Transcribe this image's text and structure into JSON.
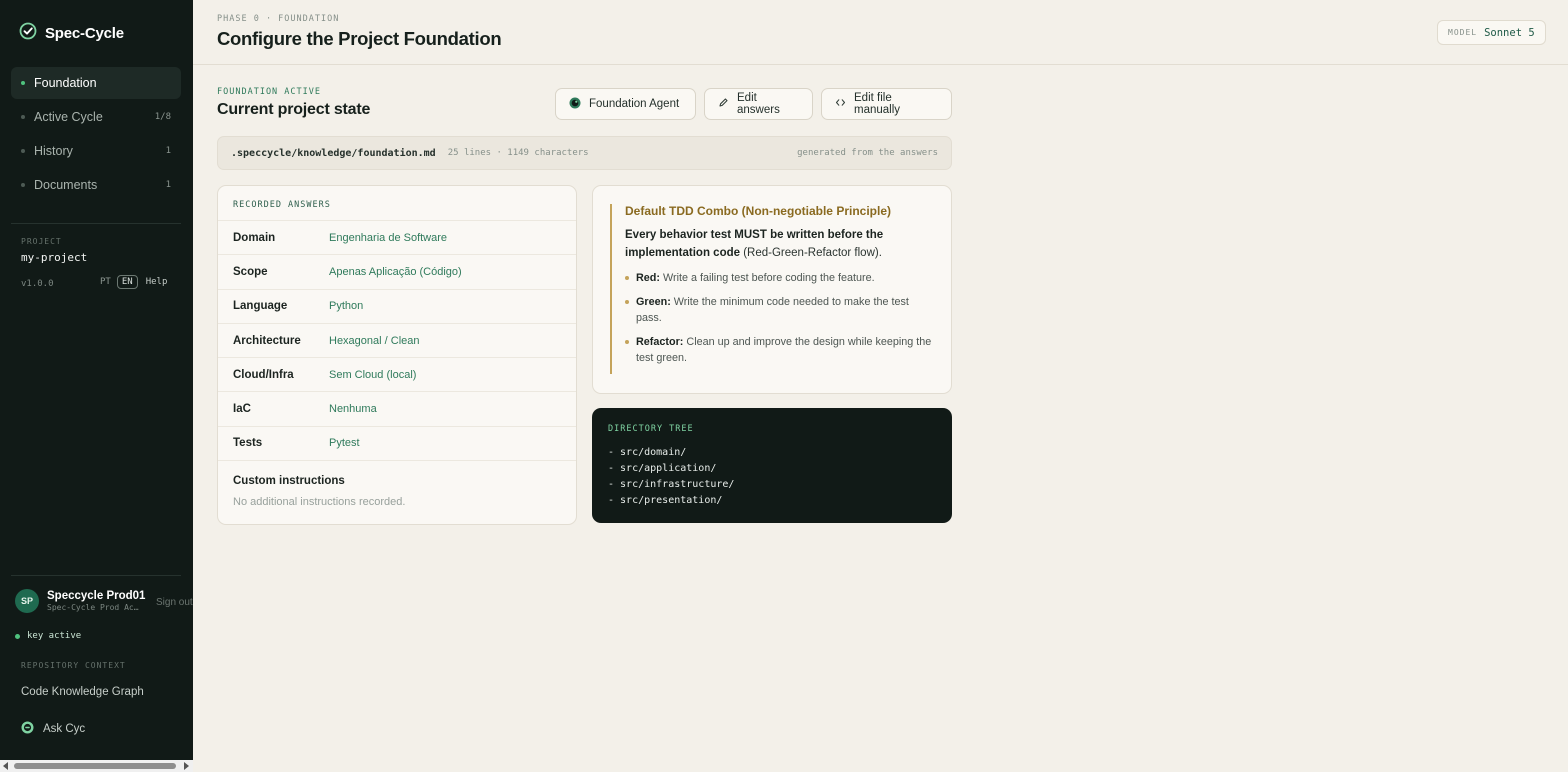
{
  "sidebar": {
    "brand": "Spec-Cycle",
    "nav": [
      {
        "label": "Foundation",
        "count": ""
      },
      {
        "label": "Active Cycle",
        "count": "1/8"
      },
      {
        "label": "History",
        "count": "1"
      },
      {
        "label": "Documents",
        "count": "1"
      }
    ],
    "project_label": "PROJECT",
    "project_name": "my-project",
    "version": "v1.0.0",
    "lang_pt": "PT",
    "lang_en": "EN",
    "help": "Help",
    "user": {
      "initials": "SP",
      "name": "Speccycle Prod01",
      "sub": "Spec-Cycle Prod Ac…",
      "signout": "Sign out"
    },
    "key_status": "key active",
    "repo_label": "REPOSITORY CONTEXT",
    "code_graph": "Code Knowledge Graph",
    "ask": "Ask Cyc"
  },
  "header": {
    "phase": "PHASE 0 · FOUNDATION",
    "title": "Configure the Project Foundation",
    "model_label": "MODEL",
    "model_value": "Sonnet 5"
  },
  "section": {
    "eyebrow": "FOUNDATION ACTIVE",
    "title": "Current project state",
    "buttons": {
      "agent": "Foundation Agent",
      "edit_answers": "Edit answers",
      "edit_file": "Edit file manually"
    }
  },
  "file": {
    "path": ".speccycle/knowledge/foundation.md",
    "stats": "25 lines · 1149 characters",
    "note": "generated from the answers"
  },
  "answers": {
    "label": "RECORDED ANSWERS",
    "rows": [
      {
        "key": "Domain",
        "value": "Engenharia de Software"
      },
      {
        "key": "Scope",
        "value": "Apenas Aplicação (Código)"
      },
      {
        "key": "Language",
        "value": "Python"
      },
      {
        "key": "Architecture",
        "value": "Hexagonal / Clean"
      },
      {
        "key": "Cloud/Infra",
        "value": "Sem Cloud (local)"
      },
      {
        "key": "IaC",
        "value": "Nenhuma"
      },
      {
        "key": "Tests",
        "value": "Pytest"
      }
    ],
    "custom_title": "Custom instructions",
    "custom_text": "No additional instructions recorded."
  },
  "tdd": {
    "title": "Default TDD Combo (Non-negotiable Principle)",
    "intro_bold": "Every behavior test MUST be written before the implementation code",
    "intro_rest": " (Red-Green-Refactor flow).",
    "items": [
      {
        "term": "Red:",
        "text": " Write a failing test before coding the feature."
      },
      {
        "term": "Green:",
        "text": " Write the minimum code needed to make the test pass."
      },
      {
        "term": "Refactor:",
        "text": " Clean up and improve the design while keeping the test green."
      }
    ]
  },
  "tree": {
    "label": "DIRECTORY TREE",
    "lines": [
      "- src/domain/",
      "- src/application/",
      "- src/infrastructure/",
      "- src/presentation/"
    ]
  },
  "colors": {
    "sidebar_bg": "#111a17",
    "accent_green": "#4fc27e",
    "accent_gold": "#c4a35a",
    "page_bg": "#f3f0e9"
  }
}
